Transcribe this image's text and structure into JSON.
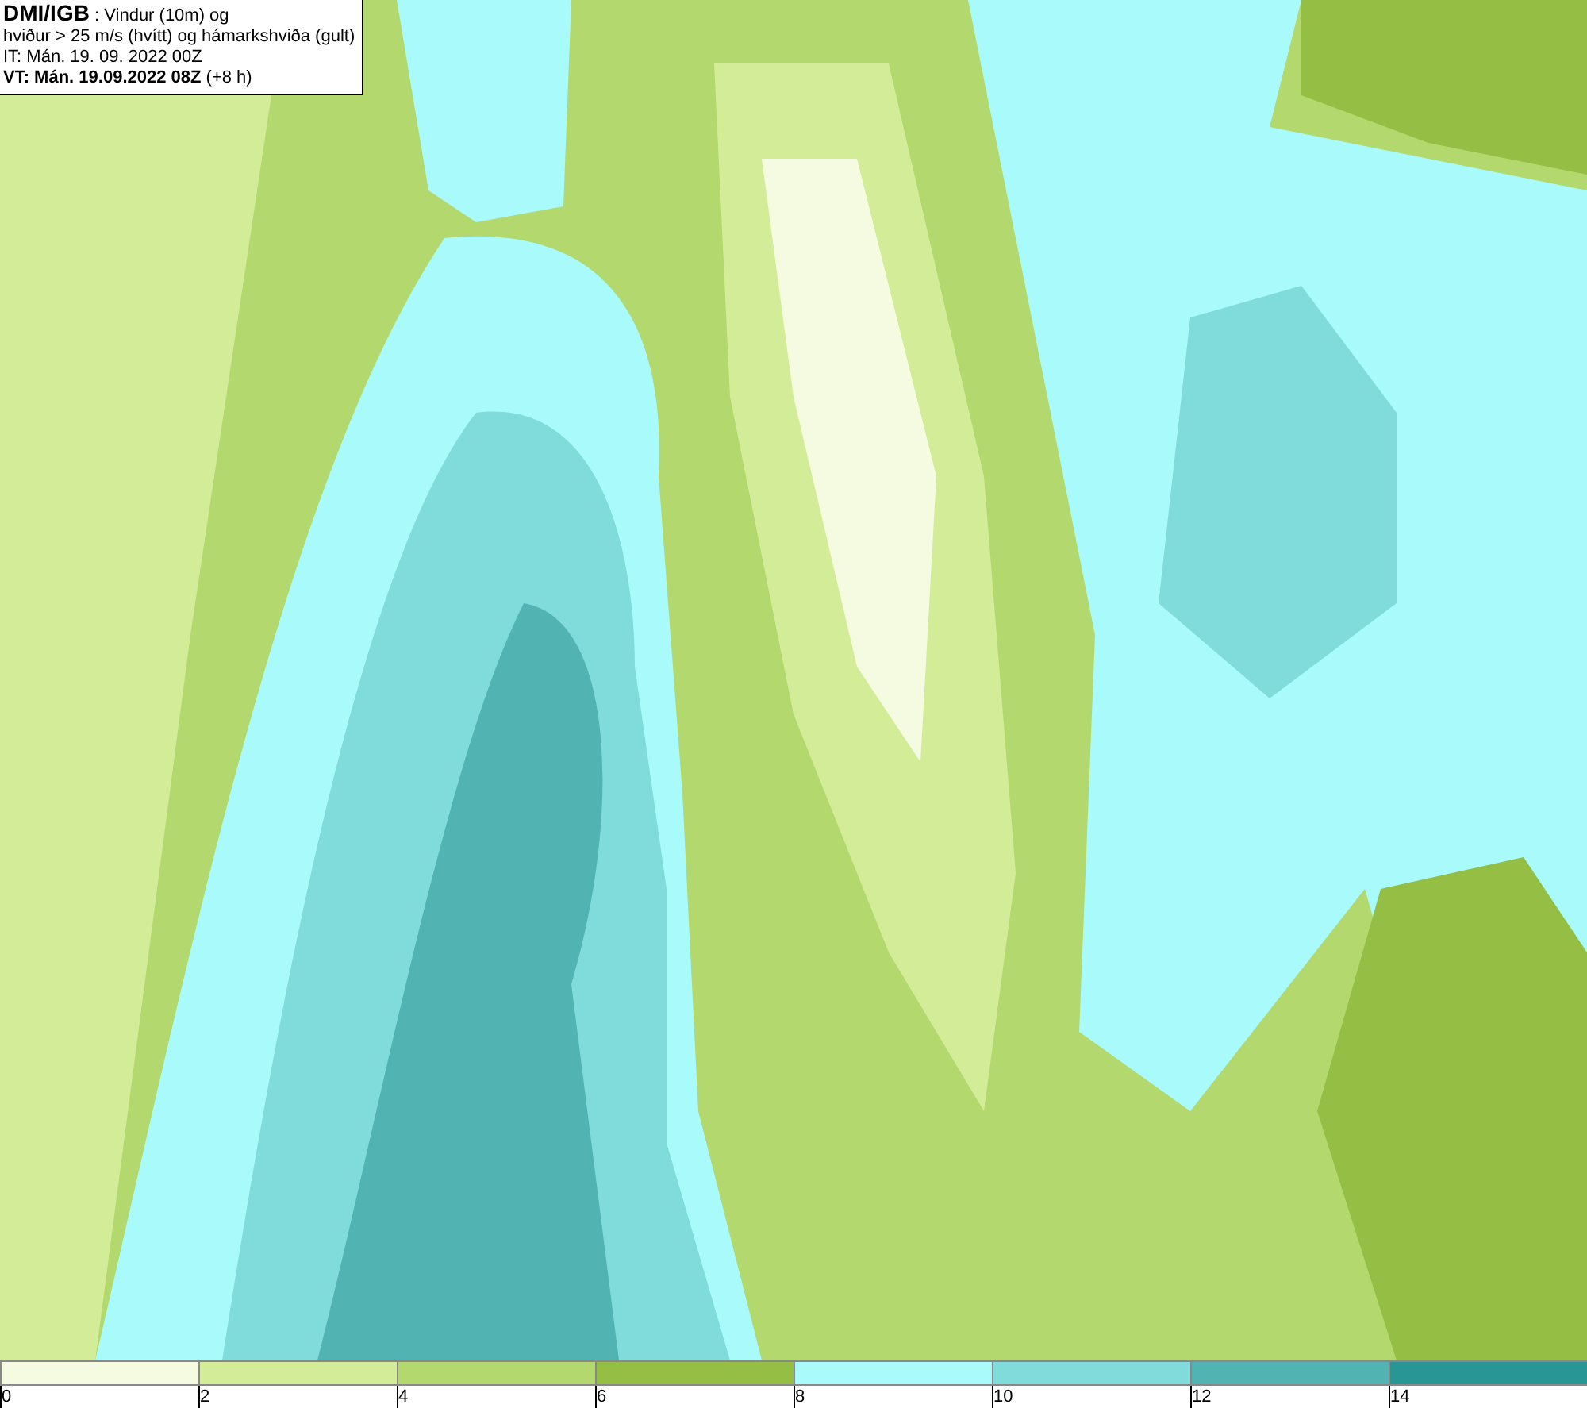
{
  "header": {
    "lines": [
      "**DMI/IGB** : Vindur (10m) og",
      "hviður > 25 m/s (hvítt) og hámarkshviða (gult)",
      "IT: Mán. 19. 09. 2022 00Z",
      "**VT: Mán. 19.09.2022 08Z** (+8 h)"
    ]
  },
  "legend": {
    "bins": [
      {
        "color": "#f4fbe0",
        "label": "0"
      },
      {
        "color": "#d3ec98",
        "label": "2"
      },
      {
        "color": "#b3d86e",
        "label": "4"
      },
      {
        "color": "#94bf44",
        "label": "6"
      },
      {
        "color": "#a8fbfa",
        "label": "8"
      },
      {
        "color": "#80dbdb",
        "label": "10"
      },
      {
        "color": "#52b3b3",
        "label": "12"
      },
      {
        "color": "#279694",
        "label": "14"
      }
    ]
  }
}
